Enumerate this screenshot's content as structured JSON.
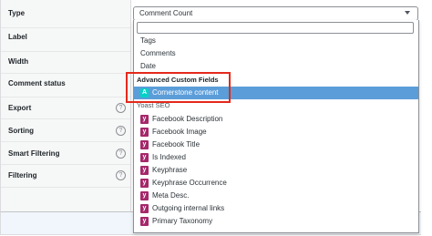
{
  "form": {
    "rows": [
      {
        "label": "Type",
        "help": false
      },
      {
        "label": "Label",
        "help": false
      },
      {
        "label": "Width",
        "help": false
      },
      {
        "label": "Comment status",
        "help": false
      },
      {
        "label": "Export",
        "help": true
      },
      {
        "label": "Sorting",
        "help": true
      },
      {
        "label": "Smart Filtering",
        "help": true
      },
      {
        "label": "Filtering",
        "help": true
      }
    ],
    "help_glyph": "?"
  },
  "type_select": {
    "value": "Comment Count",
    "search_value": ""
  },
  "dropdown": {
    "top_options": [
      "Tags",
      "Comments",
      "Date"
    ],
    "acf_group": "Advanced Custom Fields",
    "acf_icon_letter": "A",
    "acf_option": "Cornerstone content",
    "yoast_group": "Yoast SEO",
    "yoast_icon_letter": "y",
    "yoast_options": [
      "Facebook Description",
      "Facebook Image",
      "Facebook Title",
      "Is Indexed",
      "Keyphrase",
      "Keyphrase Occurrence",
      "Meta Desc.",
      "Outgoing internal links",
      "Primary Taxonomy"
    ]
  },
  "colors": {
    "highlight": "#5b9dd9",
    "acf_icon": "#00d3c6",
    "yoast_icon": "#a4286a",
    "annotation": "#e4291b"
  }
}
